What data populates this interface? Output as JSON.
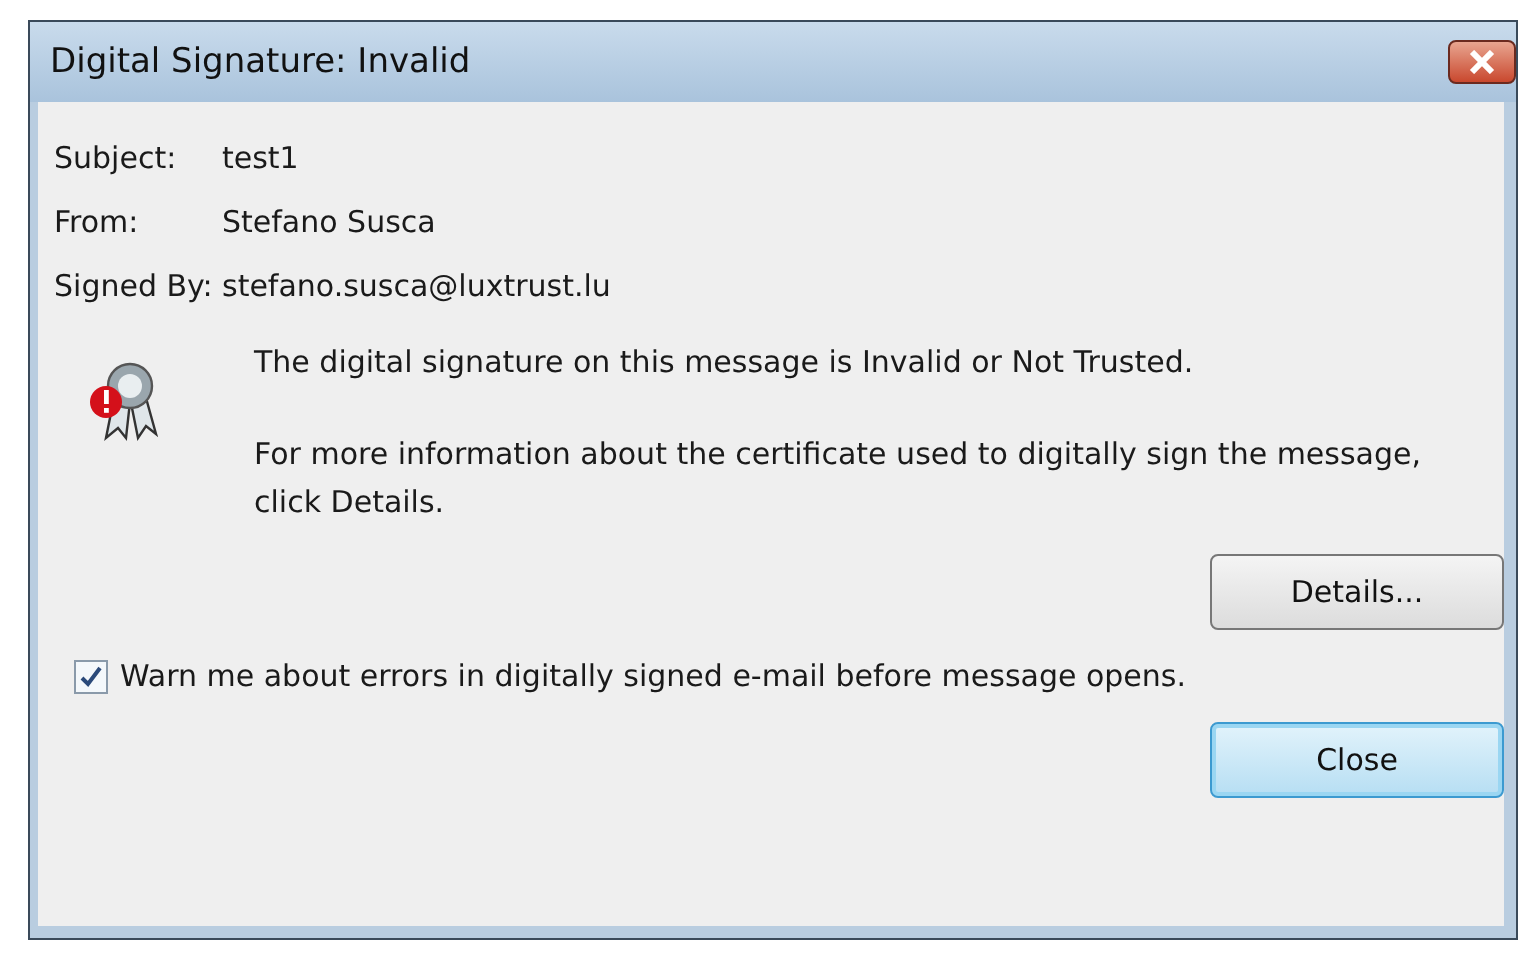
{
  "window": {
    "title": "Digital Signature: Invalid"
  },
  "fields": [
    {
      "label": "Subject:",
      "value": "test1"
    },
    {
      "label": "From:",
      "value": "Stefano Susca"
    },
    {
      "label": "Signed By:",
      "value": "stefano.susca@luxtrust.lu"
    }
  ],
  "message": "The digital signature on this message is Invalid or Not Trusted.",
  "info": "For more information about the certificate used to digitally sign the message, click Details.",
  "details_button": "Details...",
  "warn_checkbox": {
    "label": "Warn me about errors in digitally signed e-mail before message opens.",
    "checked": true
  },
  "close_button": {
    "label": "Close",
    "focused": true
  }
}
